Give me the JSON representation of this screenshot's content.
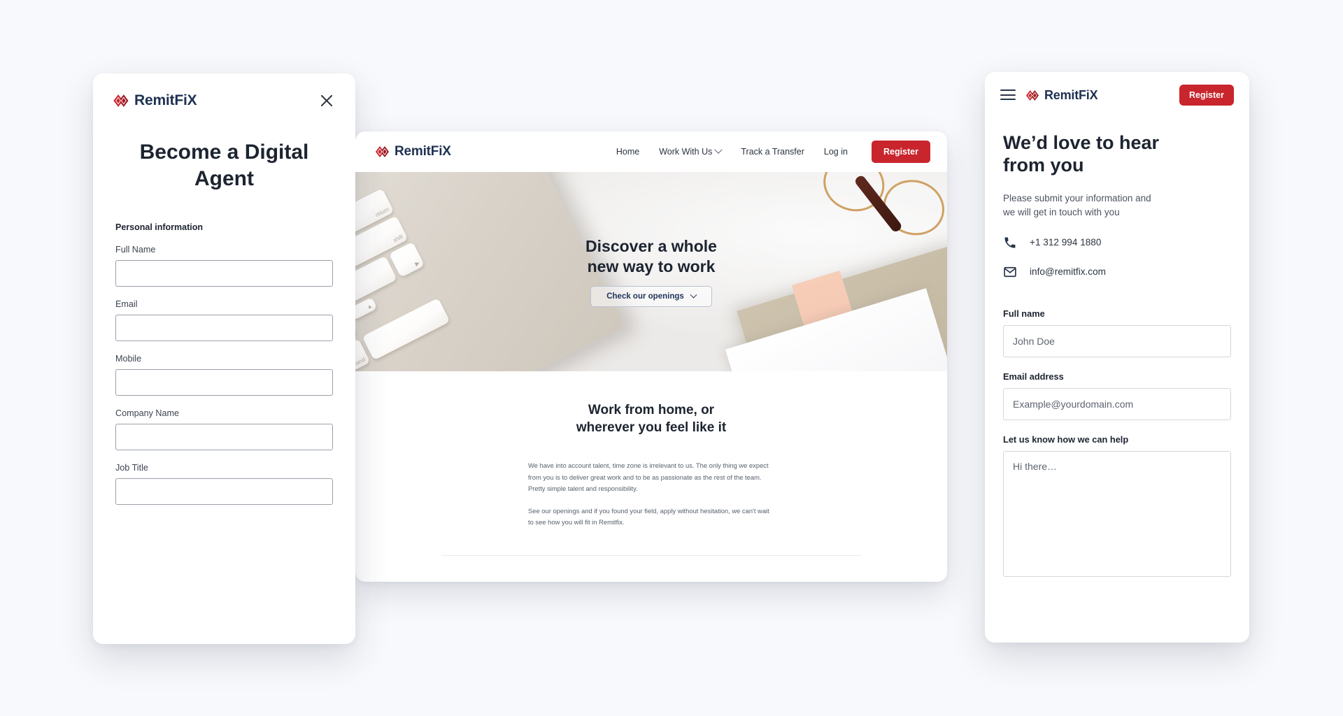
{
  "brand": {
    "name_prefix": "Remit",
    "name_f": "F",
    "name_suffix": "iX",
    "full_name": "RemitFiX",
    "accent_red": "#c9252d",
    "navy": "#1f3152"
  },
  "modal": {
    "logo_text": "RemitFiX",
    "close_label": "✕",
    "title": "Become a Digital Agent",
    "section_label": "Personal information",
    "fields": [
      {
        "label": "Full Name",
        "value": ""
      },
      {
        "label": "Email",
        "value": ""
      },
      {
        "label": "Mobile",
        "value": ""
      },
      {
        "label": "Company Name",
        "value": ""
      },
      {
        "label": "Job Title",
        "value": ""
      }
    ]
  },
  "desktop": {
    "logo_text": "RemitFiX",
    "nav": [
      {
        "label": "Home",
        "has_chevron": false
      },
      {
        "label": "Work With Us",
        "has_chevron": true
      },
      {
        "label": "Track a Transfer",
        "has_chevron": false
      },
      {
        "label": "Log in",
        "has_chevron": false
      }
    ],
    "register_label": "Register",
    "hero": {
      "title": "Discover  a whole\nnew way to work",
      "cta_label": "Check our openings"
    },
    "section": {
      "title": "Work from home, or\nwherever you feel like it",
      "paragraph_1": "We have into account talent, time zone is irrelevant to us. The only thing we expect from you is to deliver great work and to be as passionate as the rest of the team. Pretty simple talent and responsibility.",
      "paragraph_2": "See our openings and if you found your field, apply without hesitation, we can't wait to see how you will fit in Remitfix."
    }
  },
  "mobile": {
    "logo_text": "RemitFiX",
    "register_label": "Register",
    "heading": "We’d love to hear\nfrom you",
    "subheading": "Please submit your information and\nwe will get in touch with you",
    "contacts": [
      {
        "icon": "phone-icon",
        "text": "+1 312 994 1880"
      },
      {
        "icon": "envelope-icon",
        "text": "info@remitfix.com"
      }
    ],
    "form": {
      "name_label": "Full name",
      "name_placeholder": "John Doe",
      "email_label": "Email address",
      "email_placeholder": "Example@yourdomain.com",
      "message_label": "Let us know how we can help",
      "message_placeholder": "Hi there…"
    }
  }
}
